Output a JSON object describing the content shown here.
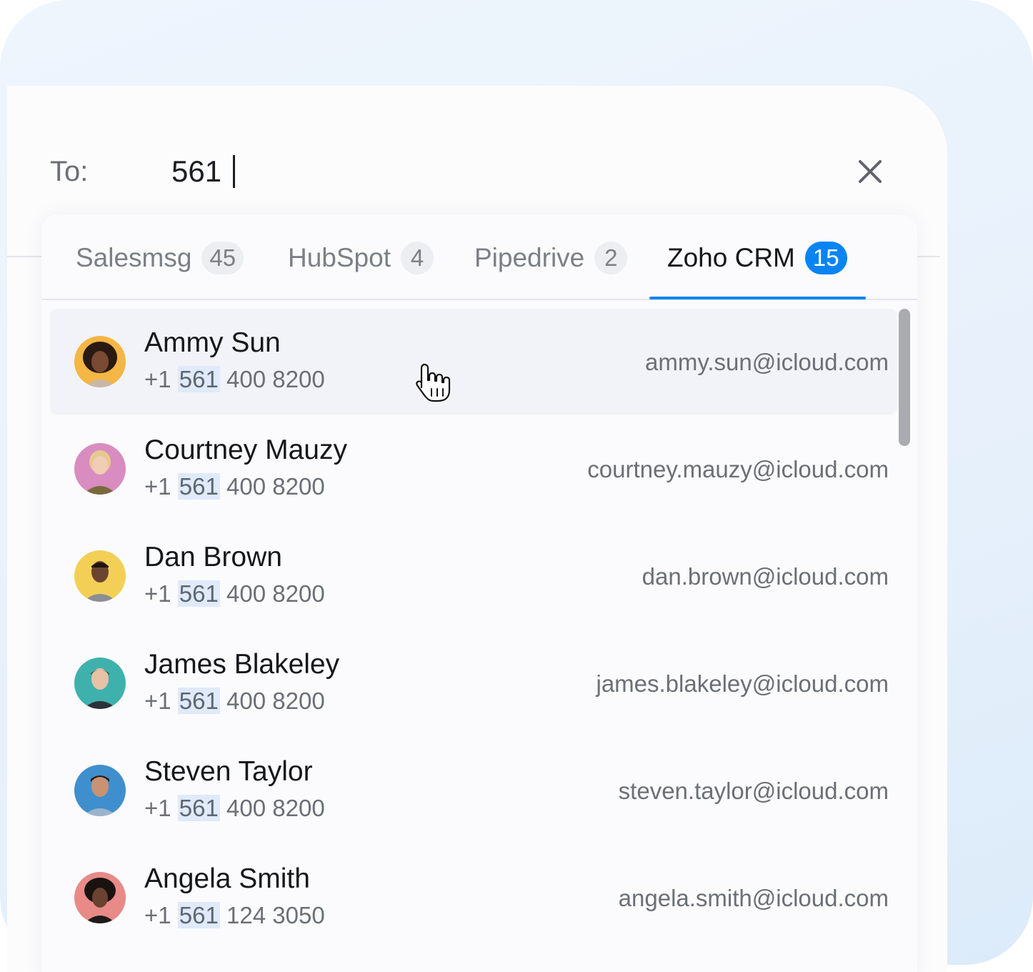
{
  "compose": {
    "to_label": "To:",
    "to_value": "561"
  },
  "icons": {
    "close": "close-icon",
    "pointer": "hand-pointer-icon"
  },
  "tabs": [
    {
      "label": "Salesmsg",
      "count": "45",
      "active": false
    },
    {
      "label": "HubSpot",
      "count": "4",
      "active": false
    },
    {
      "label": "Pipedrive",
      "count": "2",
      "active": false
    },
    {
      "label": "Zoho CRM",
      "count": "15",
      "active": true
    }
  ],
  "contacts": [
    {
      "name": "Ammy Sun",
      "phone_prefix": "+1",
      "phone_match": "561",
      "phone_rest": "400 8200",
      "email": "ammy.sun@icloud.com",
      "hovered": true,
      "avatar_bg": "#f4b644"
    },
    {
      "name": "Courtney Mauzy",
      "phone_prefix": "+1",
      "phone_match": "561",
      "phone_rest": "400 8200",
      "email": "courtney.mauzy@icloud.com",
      "hovered": false,
      "avatar_bg": "#d98cc0"
    },
    {
      "name": "Dan Brown",
      "phone_prefix": "+1",
      "phone_match": "561",
      "phone_rest": "400 8200",
      "email": "dan.brown@icloud.com",
      "hovered": false,
      "avatar_bg": "#f3cf56"
    },
    {
      "name": "James Blakeley",
      "phone_prefix": "+1",
      "phone_match": "561",
      "phone_rest": "400 8200",
      "email": "james.blakeley@icloud.com",
      "hovered": false,
      "avatar_bg": "#3fb1ad"
    },
    {
      "name": "Steven Taylor",
      "phone_prefix": "+1",
      "phone_match": "561",
      "phone_rest": "400 8200",
      "email": "steven.taylor@icloud.com",
      "hovered": false,
      "avatar_bg": "#3f8fcf"
    },
    {
      "name": "Angela Smith",
      "phone_prefix": "+1",
      "phone_match": "561",
      "phone_rest": "124 3050",
      "email": "angela.smith@icloud.com",
      "hovered": false,
      "avatar_bg": "#e88a88"
    }
  ],
  "colors": {
    "accent": "#0a84f3",
    "match_highlight": "#dfeafa",
    "hover_row": "#f2f3f8"
  }
}
